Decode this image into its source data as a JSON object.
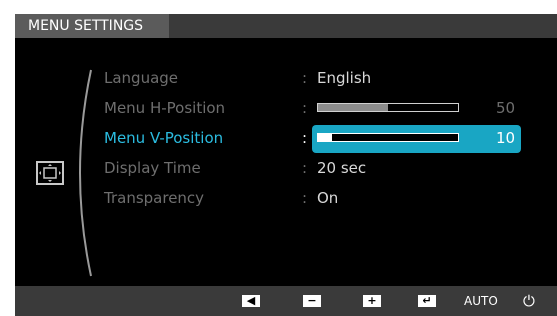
{
  "header": {
    "title": "MENU SETTINGS"
  },
  "menu": {
    "items": [
      {
        "label": "Language",
        "colon": ":",
        "value": "English"
      },
      {
        "label": "Menu H-Position",
        "colon": ":",
        "value": "50",
        "level": 50
      },
      {
        "label": "Menu V-Position",
        "colon": ":",
        "value": "10",
        "level": 10,
        "selected": true
      },
      {
        "label": "Display Time",
        "colon": ":",
        "value": "20 sec"
      },
      {
        "label": "Transparency",
        "colon": ":",
        "value": "On"
      }
    ]
  },
  "section_icon": "menu-position-icon",
  "footer": {
    "buttons": [
      {
        "icon": "left-arrow-icon"
      },
      {
        "icon": "minus-icon"
      },
      {
        "icon": "plus-icon"
      },
      {
        "icon": "enter-icon"
      },
      {
        "label": "AUTO"
      },
      {
        "icon": "power-icon"
      }
    ]
  },
  "colors": {
    "accent": "#16a7c6",
    "highlight_text": "#2bbce0",
    "osd_bg": "#000000"
  }
}
